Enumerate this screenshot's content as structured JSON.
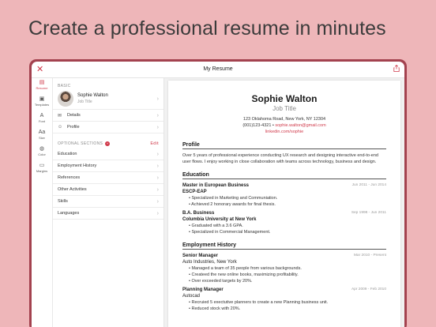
{
  "headline": "Create a professional resume in minutes",
  "window": {
    "title": "My Resume",
    "close_icon": "close-icon",
    "share_icon": "share-icon"
  },
  "rail": [
    {
      "key": "resume",
      "label": "Resume",
      "icon": "resume-icon",
      "glyph": "▤"
    },
    {
      "key": "templates",
      "label": "Templates",
      "icon": "templates-icon",
      "glyph": "▣"
    },
    {
      "key": "font",
      "label": "Font",
      "icon": "font-icon",
      "glyph": "A"
    },
    {
      "key": "size",
      "label": "Size",
      "icon": "size-icon",
      "glyph": "Aa"
    },
    {
      "key": "color",
      "label": "Color",
      "icon": "color-icon",
      "glyph": "◍"
    },
    {
      "key": "margins",
      "label": "Margins",
      "icon": "margins-icon",
      "glyph": "▭"
    }
  ],
  "panel": {
    "basic_label": "BASIC",
    "profile_name": "Sophie Walton",
    "profile_title": "Job Title",
    "details_label": "Details",
    "profile_label": "Profile",
    "optional_label": "OPTIONAL SECTIONS",
    "optional_badge": "+",
    "edit_label": "Edit",
    "sections": [
      "Education",
      "Employment History",
      "References",
      "Other Activities",
      "Skills",
      "Languages"
    ]
  },
  "resume": {
    "name": "Sophie Walton",
    "job_title": "Job Title",
    "address": "123 Oklahoma Road, New York, NY 12304",
    "phone": "(001)123-4321",
    "email": "sophie.walton@gmail.com",
    "linkedin": "linkedin.com/sophie",
    "profile_heading": "Profile",
    "profile_text": "Over 5 years of professional experience conducting UX research and designing interactive end-to-end user flows. I enjoy working in close collaboration with teams across technology, business and design.",
    "education_heading": "Education",
    "education": [
      {
        "degree": "Master in European Business",
        "dates": "Jun 2011 - Jun 2014",
        "school": "ESCP-EAP",
        "bullets": [
          "Specialized in Marketing and Communiation.",
          "Achieved 2 honorary awards for final thesis."
        ]
      },
      {
        "degree": "B.A. Business",
        "dates": "Sep 1998 - Jun 2011",
        "school": "Columbia University at New York",
        "bullets": [
          "Graduated with a 3.6 GPA.",
          "Specialized in Commercial Management."
        ]
      }
    ],
    "employment_heading": "Employment History",
    "employment": [
      {
        "role": "Senior Manager",
        "dates": "Mar 2010 - Present",
        "company": "Auto Industries, New York",
        "bullets": [
          "Managed a team of 35 people from various backgrounds.",
          "Createed the new online books, maximizing profitability.",
          "Over exceeded targets by 20%."
        ]
      },
      {
        "role": "Planning Manager",
        "dates": "Apr 2009 - Feb 2010",
        "company": "Autocad",
        "bullets": [
          "Recruied 5 exectutive planners to create a new Planning business unit.",
          "Reduced stock with 20%."
        ]
      }
    ]
  }
}
